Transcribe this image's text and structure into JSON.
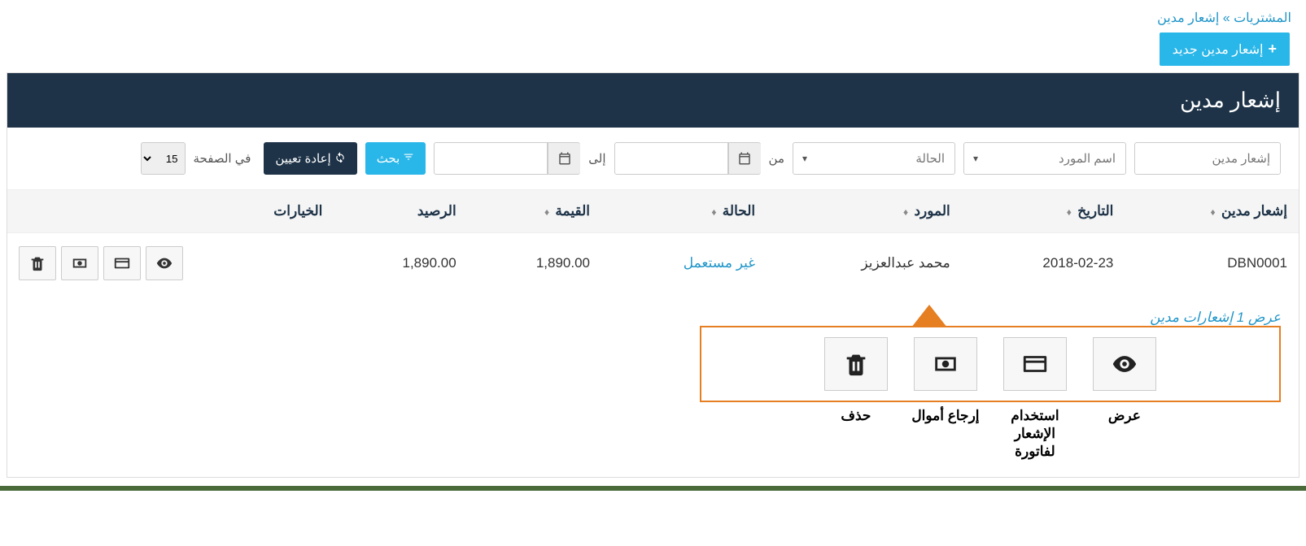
{
  "breadcrumb": {
    "root": "المشتريات",
    "sep": "»",
    "current": "إشعار مدين"
  },
  "actions": {
    "new_label": "إشعار مدين جديد"
  },
  "panel": {
    "title": "إشعار مدين"
  },
  "filters": {
    "id_placeholder": "إشعار مدين",
    "supplier_placeholder": "اسم المورد",
    "status_placeholder": "الحالة",
    "from_label": "من",
    "to_label": "إلى",
    "search_label": "بحث",
    "reset_label": "إعادة تعيين",
    "page_label": "في الصفحة",
    "page_value": "15"
  },
  "table": {
    "headers": {
      "id": "إشعار مدين",
      "date": "التاريخ",
      "supplier": "المورد",
      "status": "الحالة",
      "amount": "القيمة",
      "balance": "الرصيد",
      "options": "الخيارات"
    },
    "rows": [
      {
        "id": "DBN0001",
        "date": "2018-02-23",
        "supplier": "محمد عبدالعزيز",
        "status": "غير مستعمل",
        "amount": "1,890.00",
        "balance": "1,890.00"
      }
    ]
  },
  "summary": "عرض 1 إشعارات مدين",
  "callout": {
    "delete": "حذف",
    "refund": "إرجاع أموال",
    "apply": "استخدام الإشعار لفاتورة",
    "view": "عرض"
  }
}
